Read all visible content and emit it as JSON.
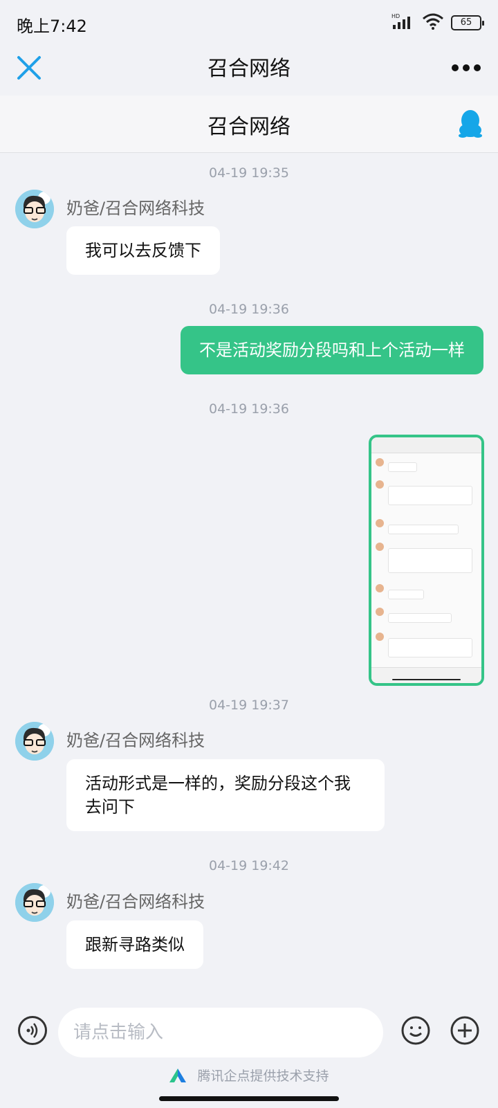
{
  "status": {
    "time": "晚上7:42",
    "network": "HD",
    "battery": "65"
  },
  "topbar": {
    "title": "召合网络"
  },
  "subheader": {
    "title": "召合网络"
  },
  "messages": [
    {
      "timestamp": "04-19 19:35",
      "sender": "奶爸/召合网络科技",
      "text": "我可以去反馈下"
    },
    {
      "timestamp": "04-19 19:36",
      "text": "不是活动奖励分段吗和上个活动一样"
    },
    {
      "timestamp": "04-19 19:36"
    },
    {
      "timestamp": "04-19 19:37",
      "sender": "奶爸/召合网络科技",
      "text": "活动形式是一样的，奖励分段这个我去问下"
    },
    {
      "timestamp": "04-19 19:42",
      "sender": "奶爸/召合网络科技",
      "text": "跟新寻路类似"
    }
  ],
  "input": {
    "placeholder": "请点击输入"
  },
  "footer": {
    "text": "腾讯企点提供技术支持"
  },
  "colors": {
    "accent": "#35c488",
    "close": "#1fa0e8",
    "qq": "#15a6e8"
  }
}
